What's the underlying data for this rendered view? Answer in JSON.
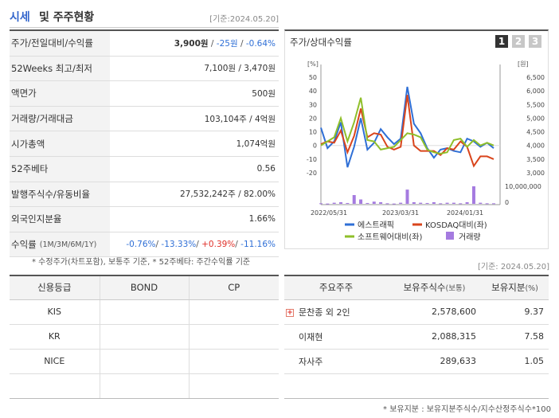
{
  "header": {
    "title_a": "시세",
    "title_b": "및 주주현황",
    "date": "[기준:2024.05.20]"
  },
  "info": {
    "price_label": "주가/전일대비/수익률",
    "price": "3,900원",
    "change": "-25원",
    "change_pct": "-0.64%",
    "weeks_label": "52Weeks 최고/최저",
    "weeks_val": "7,100원 / 3,470원",
    "par_label": "액면가",
    "par_val": "500원",
    "volume_label": "거래량/거래대금",
    "volume_val": "103,104주 / 4억원",
    "mcap_label": "시가총액",
    "mcap_val": "1,074억원",
    "beta_label": "52주베타",
    "beta_val": "0.56",
    "shares_label": "발행주식수/유동비율",
    "shares_val": "27,532,242주 / 82.00%",
    "foreign_label": "외국인지분율",
    "foreign_val": "1.66%",
    "return_label": "수익률",
    "return_sub": "(1M/3M/6M/1Y)",
    "r1": "-0.76%",
    "r2": "-13.33%",
    "r3": "+0.39%",
    "r4": "-11.16%"
  },
  "notes": {
    "left": "* 수정주가(차트포함), 보통주 기준, * 52주베타: 주간수익률 기준",
    "right_date": "[기준: 2024.05.20]",
    "holders": "* 보유지분 : 보유지분주식수/지수산정주식수*100"
  },
  "chart_panel": {
    "title": "주가/상대수익률",
    "pages": [
      "1",
      "2",
      "3"
    ]
  },
  "chart_data": {
    "type": "line",
    "y_left_label": "[%]",
    "y_right_label": "[원]",
    "y_left_ticks": [
      "50",
      "40",
      "30",
      "20",
      "10",
      "0",
      "-10",
      "-20"
    ],
    "y_right_ticks": [
      "6,500",
      "6,000",
      "5,500",
      "5,000",
      "4,500",
      "4,000",
      "3,500",
      "3,000"
    ],
    "vol_ticks": [
      "10,000,000",
      "0"
    ],
    "x_labels": [
      "2022/05/31",
      "2023/03/31",
      "2024/01/31"
    ],
    "ylim": [
      -25,
      50
    ],
    "series": [
      {
        "name": "에스트래픽",
        "color": "#2f6fd6",
        "values": [
          13,
          -2,
          3,
          17,
          -16,
          -1,
          20,
          -3,
          2,
          12,
          6,
          1,
          5,
          43,
          16,
          9,
          -2,
          -9,
          -3,
          -2,
          -4,
          -5,
          5,
          3,
          -1,
          2,
          -2
        ]
      },
      {
        "name": "KOSDAQ대비(좌)",
        "color": "#d9451c",
        "values": [
          1,
          3,
          2,
          11,
          -5,
          7,
          27,
          6,
          9,
          8,
          -1,
          -3,
          -1,
          37,
          0,
          -4,
          -4,
          -4,
          -7,
          -2,
          -3,
          3,
          -1,
          -15,
          -8,
          -8,
          -10
        ]
      },
      {
        "name": "소프트웨어대비(좌)",
        "color": "#8fbf2a",
        "values": [
          0,
          3,
          6,
          20,
          3,
          17,
          35,
          4,
          3,
          -3,
          -2,
          -1,
          4,
          9,
          8,
          6,
          -3,
          -5,
          -6,
          -5,
          4,
          5,
          -1,
          4,
          0,
          2,
          0
        ]
      }
    ],
    "volume_name": "거래량",
    "volume_color": "#a57be0",
    "volume": [
      0.1,
      0.05,
      0.2,
      0.3,
      0.15,
      1.6,
      0.8,
      0.15,
      0.4,
      0.3,
      0.1,
      0.05,
      0.2,
      2.6,
      0.3,
      0.2,
      0.15,
      0.3,
      0.1,
      0.2,
      0.2,
      0.1,
      0.3,
      3.2,
      0.2,
      0.1,
      0.1
    ]
  },
  "credit": {
    "headers": [
      "신용등급",
      "BOND",
      "CP"
    ],
    "rows": [
      [
        "KIS",
        "",
        ""
      ],
      [
        "KR",
        "",
        ""
      ],
      [
        "NICE",
        "",
        ""
      ],
      [
        "",
        "",
        ""
      ]
    ]
  },
  "holders": {
    "h_name": "주요주주",
    "h_shares": "보유주식수",
    "h_shares_sub": "(보통)",
    "h_pct": "보유지분",
    "h_pct_sub": "(%)",
    "rows": [
      {
        "name": "문찬종 외 2인",
        "shares": "2,578,600",
        "pct": "9.37"
      },
      {
        "name": "이재현",
        "shares": "2,088,315",
        "pct": "7.58"
      },
      {
        "name": "자사주",
        "shares": "289,633",
        "pct": "1.05"
      }
    ]
  }
}
